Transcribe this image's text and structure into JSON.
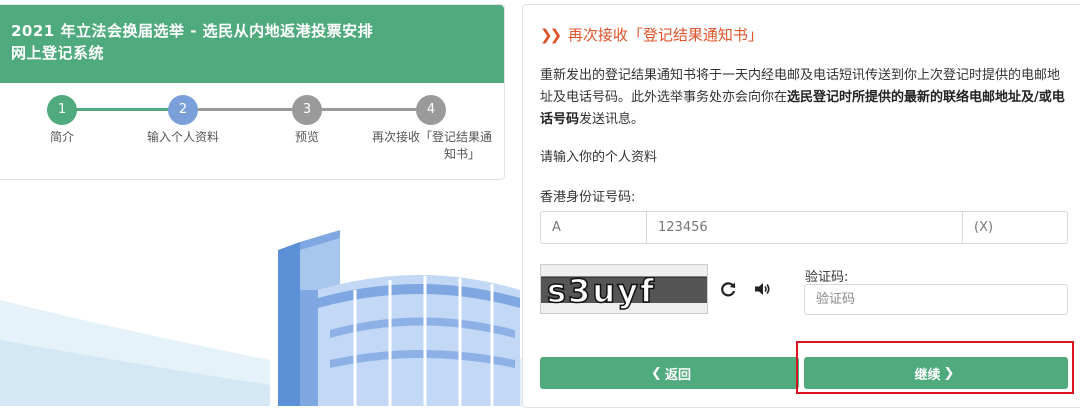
{
  "header": {
    "title_line1": "2021 年立法会换届选举 - 选民从内地返港投票安排",
    "title_line2": "网上登记系统"
  },
  "steps": [
    {
      "number": "1",
      "label_line1": "简介",
      "label_line2": "",
      "state": "done"
    },
    {
      "number": "2",
      "label_line1": "输入个人资料",
      "label_line2": "",
      "state": "current"
    },
    {
      "number": "3",
      "label_line1": "预览",
      "label_line2": "",
      "state": "pending"
    },
    {
      "number": "4",
      "label_line1": "再次接收「登记结果通",
      "label_line2": "知书」",
      "state": "pending"
    }
  ],
  "form": {
    "section_title": "再次接收「登记结果通知书」",
    "notice_part1": "重新发出的登记结果通知书将于一天内经电邮及电话短讯传送到你上次登记时提供的电邮地址及电话号码。此外选举事务处亦会向你在",
    "notice_bold": "选民登记时所提供的最新的联络电邮地址及/或电话号码",
    "notice_part2": "发送讯息。",
    "prompt": "请输入你的个人资料",
    "hkid_label": "香港身份证号码:",
    "hkid_prefix": "A",
    "hkid_digits": "123456",
    "hkid_check": "(X)",
    "captcha_text": "s3uyf",
    "captcha_label": "验证码:",
    "captcha_placeholder": "验证码",
    "back_button": "返回",
    "next_button": "继续"
  },
  "colors": {
    "brand_green": "#4faa7e",
    "step_blue": "#7b9fd8",
    "step_grey": "#9a9a9a",
    "title_orange": "#e0542b",
    "highlight_red": "#d9141f"
  },
  "icons": {
    "refresh": "refresh-icon",
    "audio": "speaker-icon",
    "section_marker": "double-chevron-right-icon"
  }
}
